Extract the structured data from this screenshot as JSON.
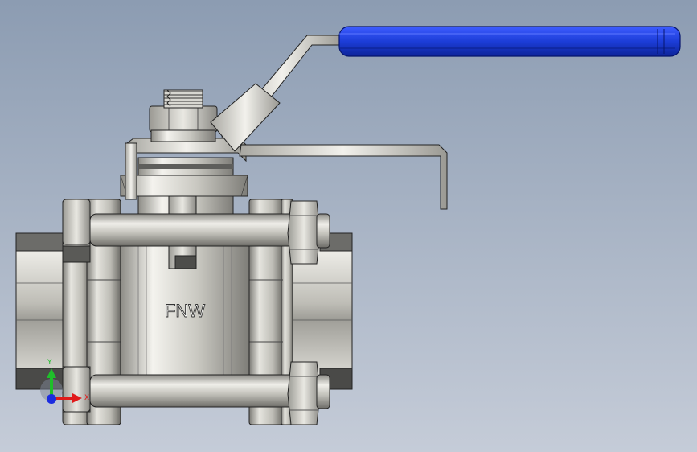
{
  "viewport": {
    "background_top": "#8c9cb2",
    "background_bottom": "#c5ccd8"
  },
  "model": {
    "body_marking": "FNW",
    "handle_grip_color": "#1c3dd8",
    "metal_color": "#d6d4cc"
  },
  "triad": {
    "x_label": "X",
    "y_label": "Y",
    "x_color": "#e01a1a",
    "y_color": "#1fbf2a",
    "z_color": "#1a2be0"
  }
}
